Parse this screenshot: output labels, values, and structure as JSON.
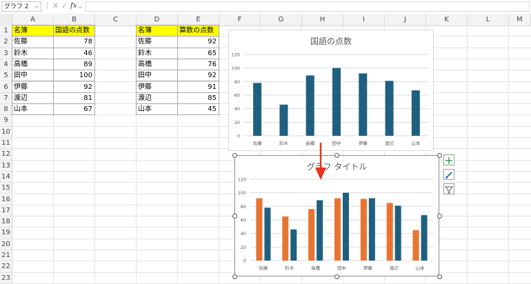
{
  "formula_bar": {
    "name_box": "グラフ 2",
    "fx_label": "fx",
    "formula": ""
  },
  "columns": [
    "A",
    "B",
    "C",
    "D",
    "E",
    "F",
    "G",
    "H",
    "I",
    "J",
    "K",
    "L",
    "M"
  ],
  "rows": [
    "1",
    "2",
    "3",
    "4",
    "5",
    "6",
    "7",
    "8",
    "9",
    "10",
    "11",
    "12",
    "13",
    "14",
    "15",
    "16",
    "17",
    "18",
    "19",
    "20",
    "21",
    "22",
    "23"
  ],
  "table1": {
    "headers": [
      "名簿",
      "国語の点数"
    ],
    "rows": [
      [
        "佐藤",
        "78"
      ],
      [
        "鈴木",
        "46"
      ],
      [
        "高橋",
        "89"
      ],
      [
        "田中",
        "100"
      ],
      [
        "伊藤",
        "92"
      ],
      [
        "渡辺",
        "81"
      ],
      [
        "山本",
        "67"
      ]
    ]
  },
  "table2": {
    "headers": [
      "名簿",
      "算数の点数"
    ],
    "rows": [
      [
        "佐藤",
        "92"
      ],
      [
        "鈴木",
        "65"
      ],
      [
        "高橋",
        "76"
      ],
      [
        "田中",
        "92"
      ],
      [
        "伊藤",
        "91"
      ],
      [
        "渡辺",
        "85"
      ],
      [
        "山本",
        "45"
      ]
    ]
  },
  "chart_data": [
    {
      "type": "bar",
      "title": "国語の点数",
      "categories": [
        "佐藤",
        "鈴木",
        "高橋",
        "田中",
        "伊藤",
        "渡辺",
        "山本"
      ],
      "series": [
        {
          "values": [
            78,
            46,
            89,
            100,
            92,
            81,
            67
          ],
          "color": "#1f5f7f"
        }
      ],
      "ylim": [
        0,
        120
      ],
      "yticks": [
        0,
        20,
        40,
        60,
        80,
        100,
        120
      ],
      "grid": true
    },
    {
      "type": "bar",
      "title": "グラフ タイトル",
      "categories": [
        "佐藤",
        "鈴木",
        "高橋",
        "田中",
        "伊藤",
        "渡辺",
        "山本"
      ],
      "series": [
        {
          "values": [
            92,
            65,
            76,
            92,
            91,
            85,
            45
          ],
          "color": "#e87432"
        },
        {
          "values": [
            78,
            46,
            89,
            100,
            92,
            81,
            67
          ],
          "color": "#1f5f7f"
        }
      ],
      "ylim": [
        0,
        120
      ],
      "yticks": [
        0,
        20,
        40,
        60,
        80,
        100,
        120
      ],
      "grid": true
    }
  ],
  "arrow_color": "#e8321e"
}
